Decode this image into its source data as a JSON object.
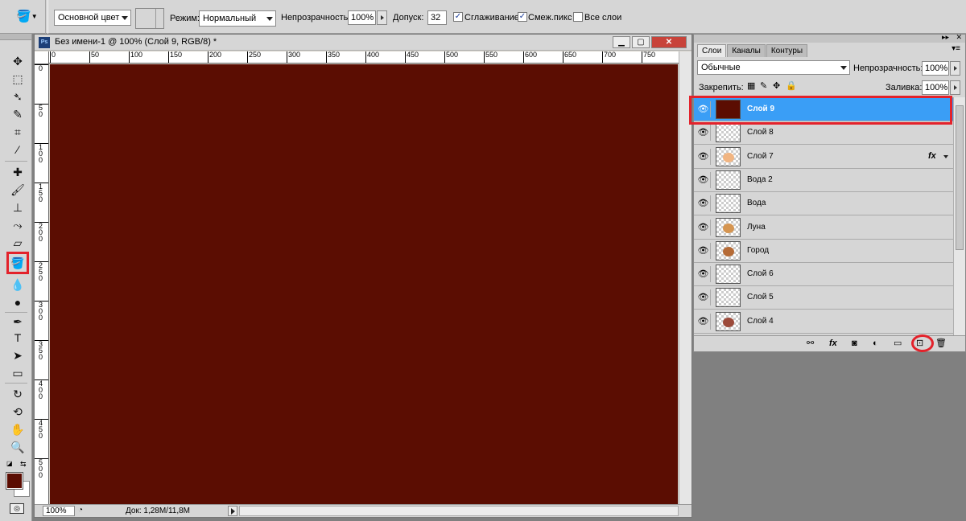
{
  "options_bar": {
    "source": "Основной цвет",
    "mode_label": "Режим:",
    "mode_value": "Нормальный",
    "opacity_label": "Непрозрачность:",
    "opacity_value": "100%",
    "tolerance_label": "Допуск:",
    "tolerance_value": "32",
    "antialias_label": "Сглаживание",
    "antialias_checked": true,
    "contiguous_label": "Смеж.пикс",
    "contiguous_checked": true,
    "all_layers_label": "Все слои",
    "all_layers_checked": false
  },
  "document": {
    "title": "Без имени-1 @ 100% (Слой 9, RGB/8) *",
    "canvas_color": "#5b0d02",
    "ruler_top": [
      "0",
      "50",
      "100",
      "150",
      "200",
      "250",
      "300",
      "350",
      "400",
      "450",
      "500",
      "550",
      "600",
      "650",
      "700",
      "750"
    ],
    "ruler_left": [
      "0",
      "50",
      "100",
      "150",
      "200",
      "250",
      "300",
      "350",
      "400",
      "450",
      "500"
    ],
    "zoom": "100%",
    "doc_info": "Док: 1,28M/11,8M"
  },
  "layers_panel": {
    "tabs": [
      "Слои",
      "Каналы",
      "Контуры"
    ],
    "blend_mode": "Обычные",
    "opacity_label": "Непрозрачность:",
    "opacity_value": "100%",
    "lock_label": "Закрепить:",
    "fill_label": "Заливка:",
    "fill_value": "100%",
    "layers": [
      {
        "name": "Слой 9",
        "active": true
      },
      {
        "name": "Слой 8",
        "active": false
      },
      {
        "name": "Слой 7",
        "active": false,
        "fx": "fx"
      },
      {
        "name": "Вода 2",
        "active": false
      },
      {
        "name": "Вода",
        "active": false
      },
      {
        "name": "Луна",
        "active": false
      },
      {
        "name": "Город",
        "active": false
      },
      {
        "name": "Слой 6",
        "active": false
      },
      {
        "name": "Слой 5",
        "active": false
      },
      {
        "name": "Слой 4",
        "active": false
      }
    ],
    "footer_icons": [
      "link-icon",
      "fx-icon",
      "mask-icon",
      "adjustment-icon",
      "folder-icon",
      "new-layer-icon",
      "trash-icon"
    ],
    "footer_fx": "fx"
  },
  "colors": {
    "foreground": "#5b0d02",
    "background": "#ffffff",
    "highlight": "#e3222b",
    "active_layer": "#3a9ef6"
  }
}
